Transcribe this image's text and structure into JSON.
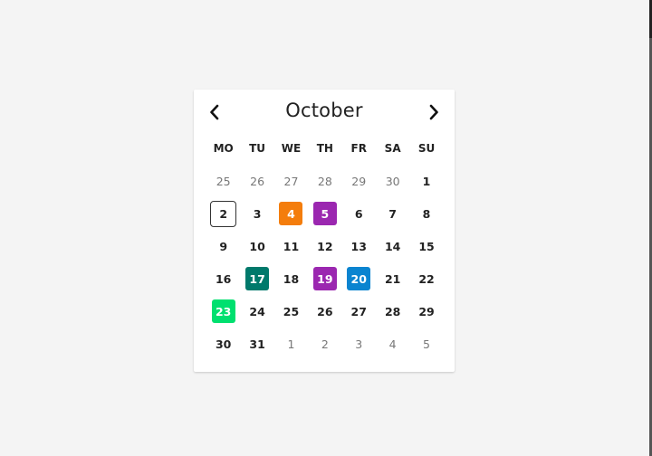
{
  "calendar": {
    "month": "October",
    "prev_icon": "chevron-left-icon",
    "next_icon": "chevron-right-icon",
    "weekdays": [
      "MO",
      "TU",
      "WE",
      "TH",
      "FR",
      "SA",
      "SU"
    ],
    "weeks": [
      [
        {
          "day": "25",
          "other": true
        },
        {
          "day": "26",
          "other": true
        },
        {
          "day": "27",
          "other": true
        },
        {
          "day": "28",
          "other": true
        },
        {
          "day": "29",
          "other": true
        },
        {
          "day": "30",
          "other": true
        },
        {
          "day": "1"
        }
      ],
      [
        {
          "day": "2",
          "today": true
        },
        {
          "day": "3"
        },
        {
          "day": "4",
          "color": "#f47d0c"
        },
        {
          "day": "5",
          "color": "#9b27b0"
        },
        {
          "day": "6"
        },
        {
          "day": "7"
        },
        {
          "day": "8"
        }
      ],
      [
        {
          "day": "9"
        },
        {
          "day": "10"
        },
        {
          "day": "11"
        },
        {
          "day": "12"
        },
        {
          "day": "13"
        },
        {
          "day": "14"
        },
        {
          "day": "15"
        }
      ],
      [
        {
          "day": "16"
        },
        {
          "day": "17",
          "color": "#00796b"
        },
        {
          "day": "18"
        },
        {
          "day": "19",
          "color": "#9b27b0"
        },
        {
          "day": "20",
          "color": "#0a84d0"
        },
        {
          "day": "21"
        },
        {
          "day": "22"
        }
      ],
      [
        {
          "day": "23",
          "color": "#00e06f"
        },
        {
          "day": "24"
        },
        {
          "day": "25"
        },
        {
          "day": "26"
        },
        {
          "day": "27"
        },
        {
          "day": "28"
        },
        {
          "day": "29"
        }
      ],
      [
        {
          "day": "30"
        },
        {
          "day": "31"
        },
        {
          "day": "1",
          "other": true
        },
        {
          "day": "2",
          "other": true
        },
        {
          "day": "3",
          "other": true
        },
        {
          "day": "4",
          "other": true
        },
        {
          "day": "5",
          "other": true
        }
      ]
    ]
  }
}
